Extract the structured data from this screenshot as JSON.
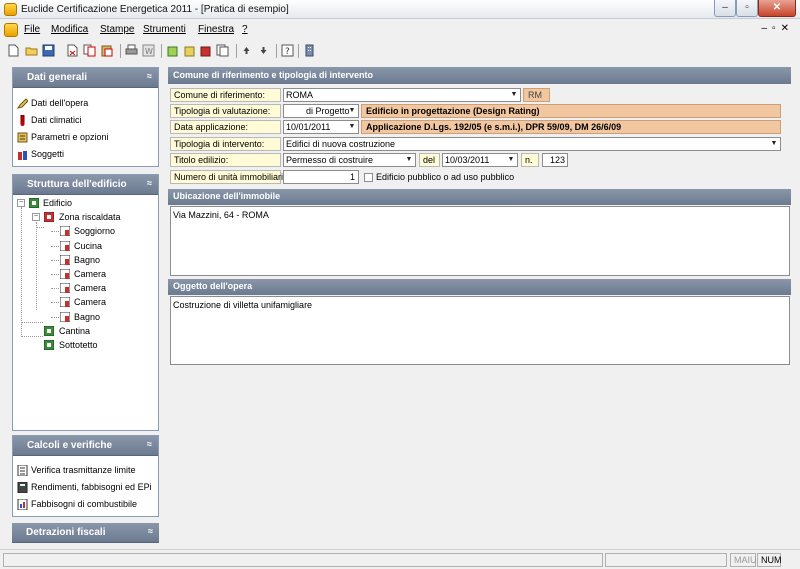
{
  "window": {
    "title": "Euclide Certificazione Energetica 2011 - [Pratica di esempio]"
  },
  "menu": [
    "File",
    "Modifica",
    "Stampe",
    "Strumenti",
    "Finestra",
    "?"
  ],
  "sidebar": {
    "dati_generali": {
      "title": "Dati generali",
      "items": [
        "Dati dell'opera",
        "Dati climatici",
        "Parametri e opzioni",
        "Soggetti"
      ]
    },
    "struttura": {
      "title": "Struttura dell'edificio",
      "tree": [
        "Edificio",
        "Zona riscaldata",
        "Soggiorno",
        "Cucina",
        "Bagno",
        "Camera",
        "Camera",
        "Camera",
        "Bagno",
        "Cantina",
        "Sottotetto"
      ]
    },
    "calcoli": {
      "title": "Calcoli e verifiche",
      "items": [
        "Verifica trasmittanze limite",
        "Rendimenti, fabbisogni ed EPi",
        "Fabbisogni di combustibile"
      ]
    },
    "detrazioni": {
      "title": "Detrazioni fiscali"
    }
  },
  "form": {
    "section_title": "Comune di riferimento e tipologia di intervento",
    "comune_label": "Comune di riferimento:",
    "comune_value": "ROMA",
    "provincia": "RM",
    "tipologia_val_label": "Tipologia di valutazione:",
    "tipologia_val_value": "di Progetto",
    "tipologia_val_desc": "Edificio in progettazione (Design Rating)",
    "data_app_label": "Data applicazione:",
    "data_app_value": "10/01/2011",
    "data_app_desc": "Applicazione D.Lgs. 192/05 (e s.m.i.), DPR 59/09, DM 26/6/09",
    "tipologia_int_label": "Tipologia di intervento:",
    "tipologia_int_value": "Edifici di nuova costruzione",
    "titolo_label": "Titolo edilizio:",
    "titolo_value": "Permesso di costruire",
    "del_label": "del",
    "titolo_date": "10/03/2011",
    "n_label": "n.",
    "n_value": "123",
    "unita_label": "Numero di unità immobiliari:",
    "unita_value": "1",
    "pubblico_label": "Edificio pubblico o ad uso pubblico",
    "pubblico_checked": false
  },
  "ubicazione": {
    "title": "Ubicazione dell'immobile",
    "value": "Via Mazzini, 64 - ROMA"
  },
  "oggetto": {
    "title": "Oggetto dell'opera",
    "value": "Costruzione di villetta unifamigliare"
  },
  "status": {
    "maiu": "MAIU",
    "num": "NUM"
  },
  "colors": {
    "header_bg": "#7b889d",
    "label_bg": "#fffbd6",
    "highlight_bg": "#f2c7a0"
  }
}
